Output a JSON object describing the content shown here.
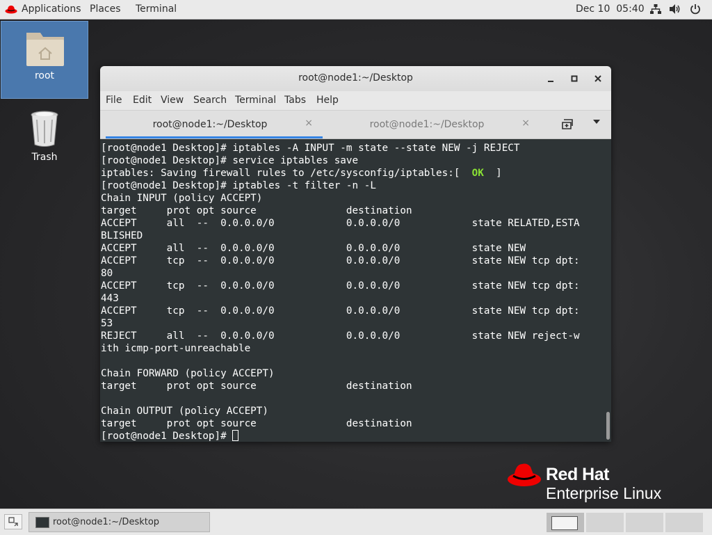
{
  "topbar": {
    "applications": "Applications",
    "places": "Places",
    "terminal": "Terminal",
    "clock": "Dec 10  05:40"
  },
  "desktop": {
    "root_label": "root",
    "trash_label": "Trash"
  },
  "window": {
    "title": "root@node1:~/Desktop",
    "menu": [
      "File",
      "Edit",
      "View",
      "Search",
      "Terminal",
      "Tabs",
      "Help"
    ],
    "tabs": [
      {
        "label": "root@node1:~/Desktop",
        "active": true
      },
      {
        "label": "root@node1:~/Desktop",
        "active": false
      }
    ],
    "close_glyph": "×"
  },
  "terminal": {
    "lines": [
      "[root@node1 Desktop]# iptables -A INPUT -m state --state NEW -j REJECT",
      "[root@node1 Desktop]# service iptables save",
      "iptables: Saving firewall rules to /etc/sysconfig/iptables:[  ",
      "[root@node1 Desktop]# iptables -t filter -n -L",
      "Chain INPUT (policy ACCEPT)",
      "target     prot opt source               destination",
      "ACCEPT     all  --  0.0.0.0/0            0.0.0.0/0            state RELATED,ESTA",
      "BLISHED",
      "ACCEPT     all  --  0.0.0.0/0            0.0.0.0/0            state NEW",
      "ACCEPT     tcp  --  0.0.0.0/0            0.0.0.0/0            state NEW tcp dpt:",
      "80",
      "ACCEPT     tcp  --  0.0.0.0/0            0.0.0.0/0            state NEW tcp dpt:",
      "443",
      "ACCEPT     tcp  --  0.0.0.0/0            0.0.0.0/0            state NEW tcp dpt:",
      "53",
      "REJECT     all  --  0.0.0.0/0            0.0.0.0/0            state NEW reject-w",
      "ith icmp-port-unreachable",
      "",
      "Chain FORWARD (policy ACCEPT)",
      "target     prot opt source               destination",
      "",
      "Chain OUTPUT (policy ACCEPT)",
      "target     prot opt source               destination",
      "[root@node1 Desktop]# "
    ],
    "ok_text": "OK",
    "ok_suffix": "  ]",
    "ok_line_index": 2
  },
  "branding": {
    "line1": "Red Hat",
    "line2": "Enterprise Linux",
    "color": "#ee0000"
  },
  "taskbar": {
    "task_label": "root@node1:~/Desktop"
  }
}
